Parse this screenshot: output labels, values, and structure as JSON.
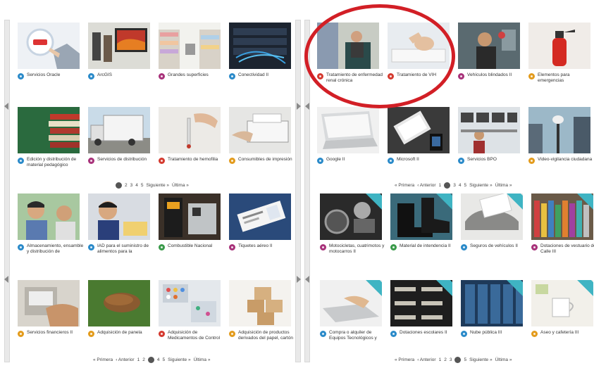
{
  "panels": {
    "top_left": {
      "cards": [
        {
          "label": "Servicios Oracle",
          "color": "#2a8ac9",
          "icon": "oracle-touch-image"
        },
        {
          "label": "ArcGIS",
          "color": "#2a8ac9",
          "icon": "arcgis-image"
        },
        {
          "label": "Grandes superficies",
          "color": "#a8327a",
          "icon": "supermarket-image"
        },
        {
          "label": "Conectividad II",
          "color": "#2a8ac9",
          "icon": "server-cables-image"
        },
        {
          "label": "Edición y distribución de material pedagógico",
          "color": "#2a8ac9",
          "icon": "books-image"
        },
        {
          "label": "Servicios de distribución",
          "color": "#a8327a",
          "icon": "truck-image"
        },
        {
          "label": "Tratamiento de hemofilia",
          "color": "#d43a2f",
          "icon": "pipette-image"
        },
        {
          "label": "Consumibles de impresión",
          "color": "#e39b1c",
          "icon": "printer-image"
        }
      ],
      "pager": {
        "current": "1",
        "pages": [
          "2",
          "3",
          "4",
          "5"
        ],
        "next": "Siguiente »",
        "last": "Última »"
      }
    },
    "bottom_left": {
      "cards": [
        {
          "label": "Almacenamiento, ensamble y distribución de",
          "color": "#2a8ac9",
          "icon": "children-eating-image"
        },
        {
          "label": "IAD para el suministro de alimentos para la",
          "color": "#2a8ac9",
          "icon": "schoolboy-image"
        },
        {
          "label": "Combustible Nacional",
          "color": "#3a9a4a",
          "icon": "fuel-pump-image"
        },
        {
          "label": "Tiquetes aéreo II",
          "color": "#a8327a",
          "icon": "plane-ticket-image"
        },
        {
          "label": "Servicios financieros II",
          "color": "#e39b1c",
          "icon": "atm-image"
        },
        {
          "label": "Adquisición de panela",
          "color": "#e39b1c",
          "icon": "panela-image"
        },
        {
          "label": "Adquisición de Medicamentos de Control",
          "color": "#d43a2f",
          "icon": "pills-image"
        },
        {
          "label": "Adquisición de productos derivados del papel, cartón",
          "color": "#e39b1c",
          "icon": "boxes-image"
        }
      ],
      "pager": {
        "first": "« Primera",
        "prev": "‹ Anterior",
        "pages_before": [
          "1",
          "2"
        ],
        "current": "3",
        "pages_after": [
          "4",
          "5"
        ],
        "next": "Siguiente »",
        "last": "Última »"
      }
    },
    "top_right": {
      "cards": [
        {
          "label": "Tratamiento de enfermedad renal crónica",
          "color": "#d43a2f",
          "icon": "dialysis-patient-image"
        },
        {
          "label": "Tratamiento de VIH",
          "color": "#d43a2f",
          "icon": "hospital-bed-image"
        },
        {
          "label": "Vehículos blindados II",
          "color": "#a8327a",
          "icon": "armored-vehicle-driver-image"
        },
        {
          "label": "Elementos para emergencias",
          "color": "#e39b1c",
          "icon": "fire-extinguisher-image"
        },
        {
          "label": "Google II",
          "color": "#2a8ac9",
          "icon": "laptop-image"
        },
        {
          "label": "Microsoft II",
          "color": "#2a8ac9",
          "icon": "tablet-desk-image"
        },
        {
          "label": "Servicios BPO",
          "color": "#2a8ac9",
          "icon": "call-center-image"
        },
        {
          "label": "Video-vigilancia ciudadana",
          "color": "#e39b1c",
          "icon": "security-camera-image"
        }
      ],
      "pager": {
        "first": "« Primera",
        "prev": "‹ Anterior",
        "pages_before": [
          "1"
        ],
        "current": "2",
        "pages_after": [
          "3",
          "4",
          "5"
        ],
        "next": "Siguiente »",
        "last": "Última »"
      }
    },
    "bottom_right": {
      "cards": [
        {
          "label": "Motocicletas, cuatrimotos y motocarros II",
          "color": "#a8327a",
          "icon": "motorcycle-image"
        },
        {
          "label": "Material de intendencia II",
          "color": "#3a9a4a",
          "icon": "boots-image"
        },
        {
          "label": "Seguros de vehículos II",
          "color": "#2a8ac9",
          "icon": "car-insurance-image"
        },
        {
          "label": "Dotaciones de vestuario de Calle III",
          "color": "#a8327a",
          "icon": "thread-spools-image"
        },
        {
          "label": "Compra o alquiler de Equipos Tecnológicos y",
          "color": "#2a8ac9",
          "icon": "typing-laptop-image"
        },
        {
          "label": "Dotaciones escolares II",
          "color": "#2a8ac9",
          "icon": "school-desks-image"
        },
        {
          "label": "Nube pública III",
          "color": "#2a8ac9",
          "icon": "data-center-image"
        },
        {
          "label": "Aseo y cafetería III",
          "color": "#e39b1c",
          "icon": "coffee-cup-image"
        }
      ],
      "pager": {
        "first": "« Primera",
        "prev": "‹ Anterior",
        "pages_before": [
          "1",
          "2",
          "3"
        ],
        "current": "4",
        "pages_after": [
          "5"
        ],
        "next": "Siguiente »",
        "last": "Última »"
      }
    }
  },
  "colors": {
    "highlight": "#d21f26",
    "ribbon": "#3fb4c3"
  }
}
